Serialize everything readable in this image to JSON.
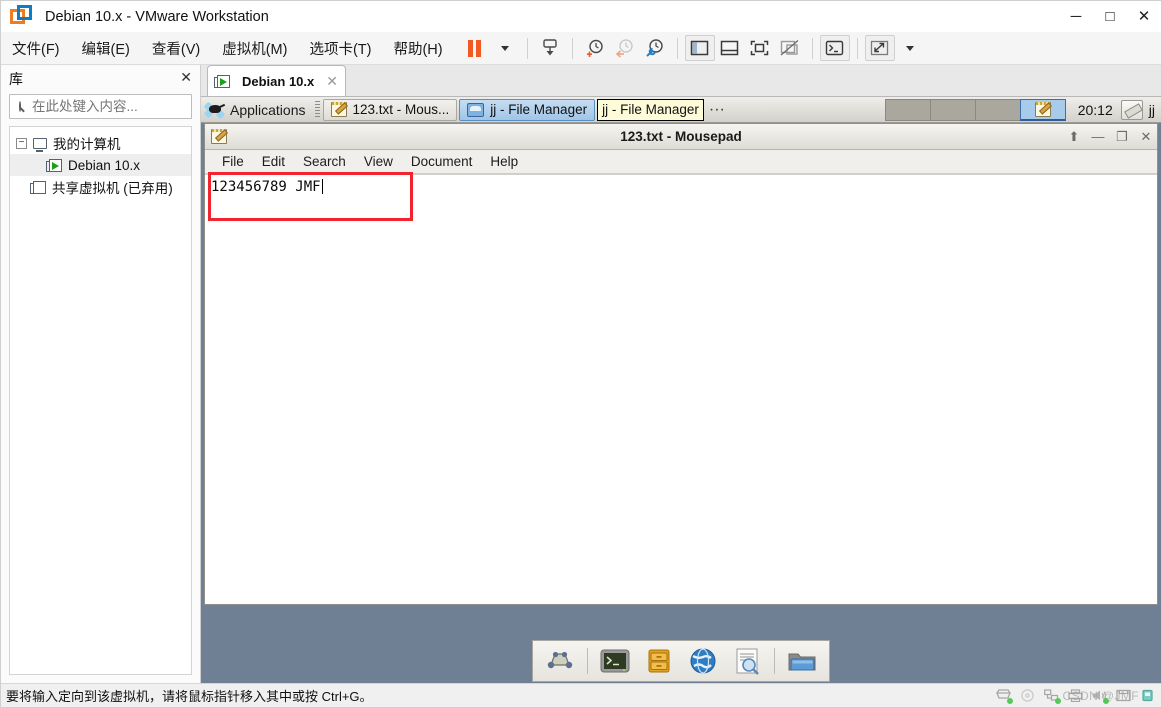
{
  "window": {
    "title": "Debian 10.x - VMware Workstation",
    "app_icon": "vmware-logo-icon",
    "minimize": "─",
    "maximize": "□",
    "close": "✕"
  },
  "menubar": {
    "items": [
      {
        "label": "文件(F)",
        "name": "menu-file"
      },
      {
        "label": "编辑(E)",
        "name": "menu-edit"
      },
      {
        "label": "查看(V)",
        "name": "menu-view"
      },
      {
        "label": "虚拟机(M)",
        "name": "menu-vm"
      },
      {
        "label": "选项卡(T)",
        "name": "menu-tabs"
      },
      {
        "label": "帮助(H)",
        "name": "menu-help"
      }
    ]
  },
  "toolbar": {
    "buttons": [
      "pause-icon",
      "dropdown-caret",
      "send-ctrl-alt-del-icon",
      "snapshot-take-icon",
      "snapshot-revert-icon",
      "snapshot-manager-icon",
      "show-library-icon",
      "show-thumbnail-bar-icon",
      "full-screen-icon",
      "unity-mode-icon",
      "console-view-icon",
      "stretch-view-icon"
    ]
  },
  "sidebar": {
    "title": "库",
    "close_label": "✕",
    "search": {
      "placeholder": "在此处键入内容...",
      "value": "",
      "icon": "search-icon",
      "dropdown_icon": "chevron-down-icon"
    },
    "tree": [
      {
        "label": "我的计算机",
        "name": "tree-my-computer",
        "expander": "−",
        "level": 1,
        "selected": false
      },
      {
        "label": "Debian 10.x",
        "name": "tree-debian-10x",
        "level": 2,
        "selected": true
      },
      {
        "label": "共享虚拟机 (已弃用)",
        "name": "tree-shared-vms",
        "level": 2,
        "selected": false
      }
    ]
  },
  "vm_tab": {
    "label": "Debian 10.x",
    "close": "✕",
    "icon": "vm-powered-on-icon"
  },
  "guest": {
    "panel": {
      "applications_label": "Applications",
      "applications_icon": "xfce-mouse-icon",
      "tasks": [
        {
          "label": "123.txt - Mous...",
          "icon": "mousepad-icon",
          "active": false,
          "name": "taskbar-item-mousepad"
        },
        {
          "label": "jj - File Manager",
          "icon": "folder-icon",
          "active": true,
          "name": "taskbar-item-file-manager"
        }
      ],
      "tooltip": {
        "label": "jj - File Manager",
        "ellipsis": "···"
      },
      "workspaces": [
        {
          "current": false
        },
        {
          "current": false
        },
        {
          "current": false
        },
        {
          "current": true,
          "icon": "mousepad-icon"
        }
      ],
      "clock": "20:12",
      "tray_icon": "eraser-icon",
      "user": "jj"
    },
    "mousepad": {
      "title": "123.txt - Mousepad",
      "icon": "mousepad-icon",
      "controls": {
        "shade": "⬆",
        "minimize": "—",
        "maximize": "❐",
        "close": "✕"
      },
      "menu": [
        "File",
        "Edit",
        "Search",
        "View",
        "Document",
        "Help"
      ],
      "content": "123456789 JMF"
    },
    "dock": [
      {
        "name": "show-desktop-icon"
      },
      {
        "name": "separator"
      },
      {
        "name": "terminal-icon"
      },
      {
        "name": "archive-manager-icon"
      },
      {
        "name": "web-browser-icon"
      },
      {
        "name": "document-viewer-icon"
      },
      {
        "name": "separator"
      },
      {
        "name": "file-manager-icon"
      }
    ]
  },
  "statusbar": {
    "message": "要将输入定向到该虚拟机，请将鼠标指针移入其中或按 Ctrl+G。",
    "watermark": "CSDN @JMF",
    "devices": [
      "hard-disk-icon",
      "cd-dvd-icon",
      "network-icon",
      "printer-icon",
      "sound-icon",
      "floppy-icon",
      "usb-icon"
    ]
  },
  "colors": {
    "accent_orange": "#f05a22",
    "accent_blue": "#0f7dc2",
    "annotation_red": "#f2242e",
    "desktop": "#6f7f94",
    "task_active": "#9fc5e8"
  }
}
